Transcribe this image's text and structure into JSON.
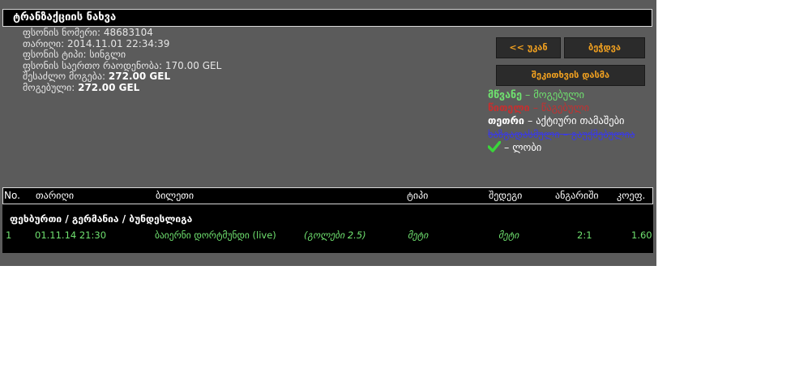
{
  "header": {
    "title": "ტრანზაქციის ნახვა"
  },
  "info": {
    "ticket_number": "ფსონის ნომერი: 48683104",
    "date": "თარიღი: 2014.11.01 22:34:39",
    "type": "ფსონის ტიპი: სინგლი",
    "total_amount": "ფსონის საერთო რაოდენობა: 170.00 GEL",
    "possible_win_label": "შესაძლო მოგება:",
    "possible_win_value": "272.00 GEL",
    "won_label": "მოგებული:",
    "won_value": "272.00 GEL"
  },
  "buttons": {
    "back": "<< უკან",
    "print": "ბეჭდვა",
    "report": "შეკითხვის დასმა"
  },
  "legend": {
    "green_word": "მწვანე",
    "green_desc": "– მოგებული",
    "red_word": "წითელი",
    "red_desc": "– წაგებული",
    "white_word": "თეთრი",
    "white_desc": "– აქტიური თამაშები",
    "blue_text": "ხაზგადასმული – გაუქმებულია",
    "lobby_desc": "– ლობი",
    "check_icon": "check-icon"
  },
  "columns": {
    "no": "No.",
    "date": "თარიღი",
    "ticket": "ბილეთი",
    "type": "ტიპი",
    "result": "შედეგი",
    "score": "ანგარიში",
    "odds": "კოეფ."
  },
  "league": "ფეხბურთი / გერმანია / ბუნდესლიგა",
  "rows": [
    {
      "no": "1",
      "date": "01.11.14 21:30",
      "match": "ბაიერნი   დორტმუნდი (live)",
      "bet": "(გოლები 2.5)",
      "type": "მეტი",
      "result": "მეტი",
      "score": "2:1",
      "odds": "1.60"
    }
  ],
  "colors": {
    "panel": "#5b5b5b",
    "accent": "#f0a020",
    "green": "#6fe16f",
    "red": "#c43030",
    "blue": "#3a3ae6"
  }
}
